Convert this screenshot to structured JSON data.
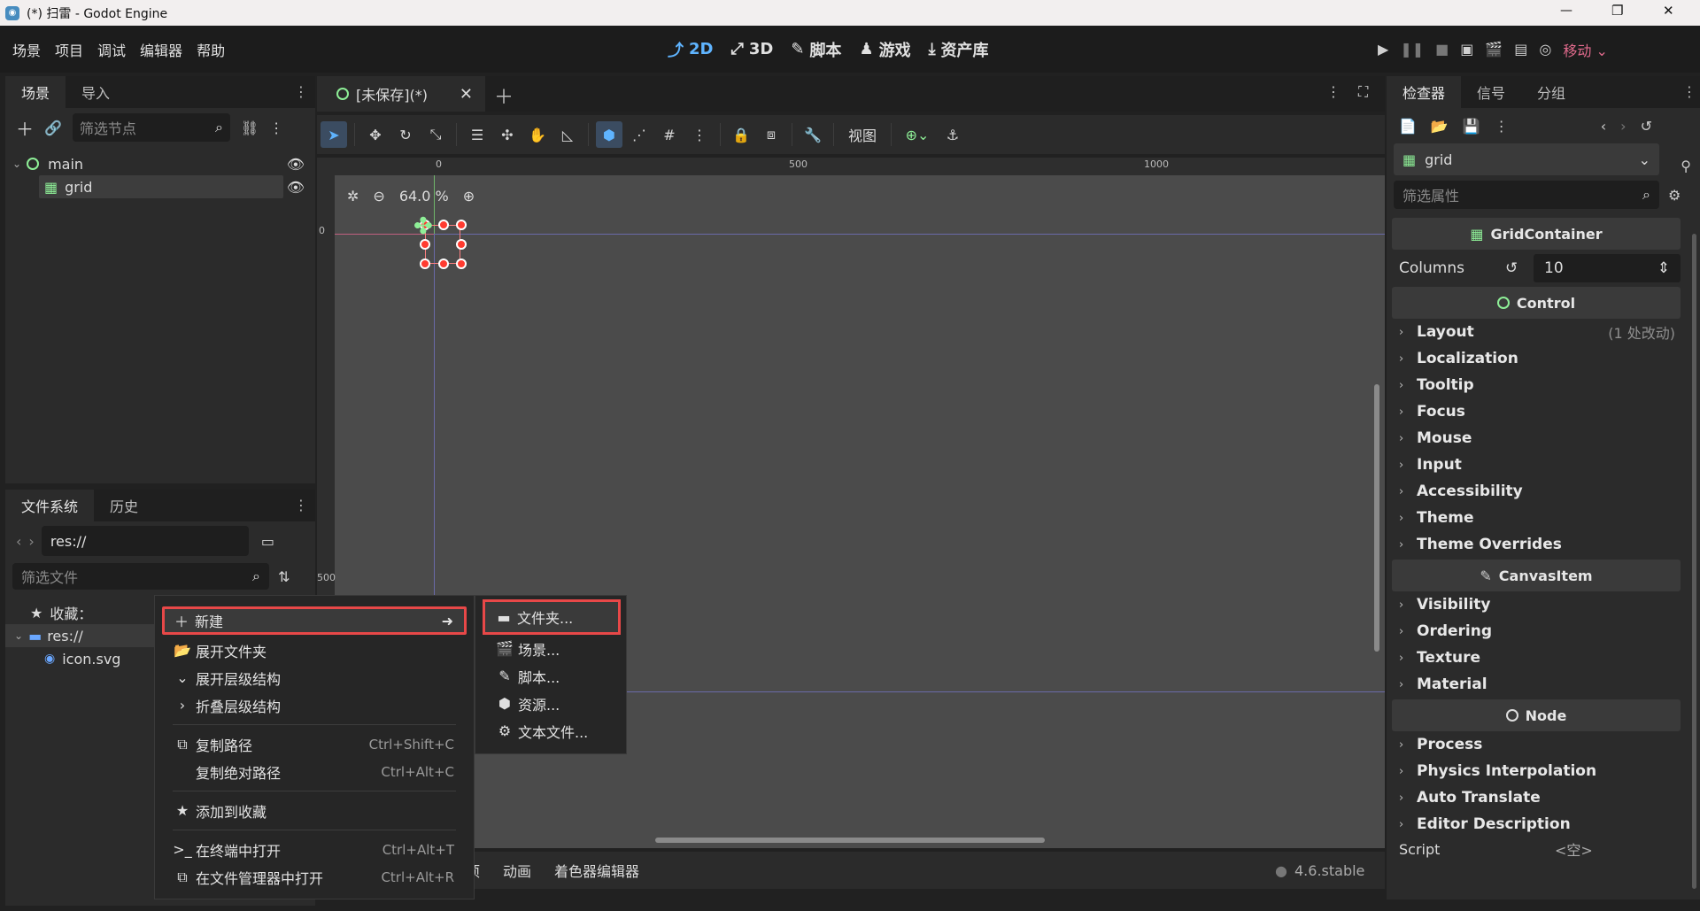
{
  "window": {
    "title": "(*) 扫雷 - Godot Engine",
    "minimize": "—",
    "maximize": "❐",
    "close": "✕"
  },
  "menubar": {
    "items": [
      "场景",
      "项目",
      "调试",
      "编辑器",
      "帮助"
    ],
    "modes": [
      {
        "label": "2D",
        "icon": "⤴"
      },
      {
        "label": "3D",
        "icon": "⤢"
      },
      {
        "label": "脚本",
        "icon": "✎"
      },
      {
        "label": "游戏",
        "icon": "♟"
      },
      {
        "label": "资产库",
        "icon": "⤓"
      }
    ],
    "renderer": "移动"
  },
  "scene_panel": {
    "tabs": [
      "场景",
      "导入"
    ],
    "filter_placeholder": "筛选节点",
    "nodes": [
      {
        "name": "main"
      },
      {
        "name": "grid"
      }
    ]
  },
  "fs_panel": {
    "tabs": [
      "文件系统",
      "历史"
    ],
    "path": "res://",
    "filter_placeholder": "筛选文件",
    "favorites": "收藏：",
    "root": "res://",
    "file": "icon.svg"
  },
  "editor": {
    "tab": "[未保存](*)",
    "view_label": "视图",
    "zoom": "64.0 %",
    "ruler": {
      "t0": "0",
      "t500": "500",
      "t1000": "1000",
      "l0": "0",
      "l500": "500"
    }
  },
  "context_menu": {
    "new": "新建",
    "items": [
      {
        "icon": "📂",
        "label": "展开文件夹",
        "shortcut": ""
      },
      {
        "icon": "⌄",
        "label": "展开层级结构",
        "shortcut": ""
      },
      {
        "icon": "›",
        "label": "折叠层级结构",
        "shortcut": ""
      },
      {
        "icon": "⧉",
        "label": "复制路径",
        "shortcut": "Ctrl+Shift+C"
      },
      {
        "icon": "",
        "label": "复制绝对路径",
        "shortcut": "Ctrl+Alt+C"
      },
      {
        "icon": "★",
        "label": "添加到收藏",
        "shortcut": ""
      },
      {
        "icon": ">_",
        "label": "在终端中打开",
        "shortcut": "Ctrl+Alt+T"
      },
      {
        "icon": "⧉",
        "label": "在文件管理器中打开",
        "shortcut": "Ctrl+Alt+R"
      }
    ]
  },
  "submenu": {
    "items": [
      {
        "icon": "▬",
        "label": "文件夹..."
      },
      {
        "icon": "🎬",
        "label": "场景..."
      },
      {
        "icon": "✎",
        "label": "脚本..."
      },
      {
        "icon": "⬢",
        "label": "资源..."
      },
      {
        "icon": "⚙",
        "label": "文本文件..."
      }
    ]
  },
  "bottom": {
    "tabs": [
      "动画",
      "着色器编辑器"
    ],
    "partial": "项",
    "version": "4.6.stable"
  },
  "inspector": {
    "tabs": [
      "检查器",
      "信号",
      "分组"
    ],
    "node": "grid",
    "filter_placeholder": "筛选属性",
    "gc": "GridContainer",
    "columns_label": "Columns",
    "columns_value": "10",
    "control": "Control",
    "control_props": [
      "Layout",
      "Localization",
      "Tooltip",
      "Focus",
      "Mouse",
      "Input",
      "Accessibility",
      "Theme",
      "Theme Overrides"
    ],
    "layout_changes": "(1 处改动)",
    "canvas": "CanvasItem",
    "canvas_props": [
      "Visibility",
      "Ordering",
      "Texture",
      "Material"
    ],
    "node_sect": "Node",
    "node_props": [
      "Process",
      "Physics Interpolation",
      "Auto Translate",
      "Editor Description"
    ],
    "script_label": "Script",
    "script_value": "<空>"
  },
  "colors": {
    "accent": "#5fb4ff",
    "highlight_border": "#e84848",
    "selection": "#ff3b30",
    "green": "#8eef97"
  }
}
